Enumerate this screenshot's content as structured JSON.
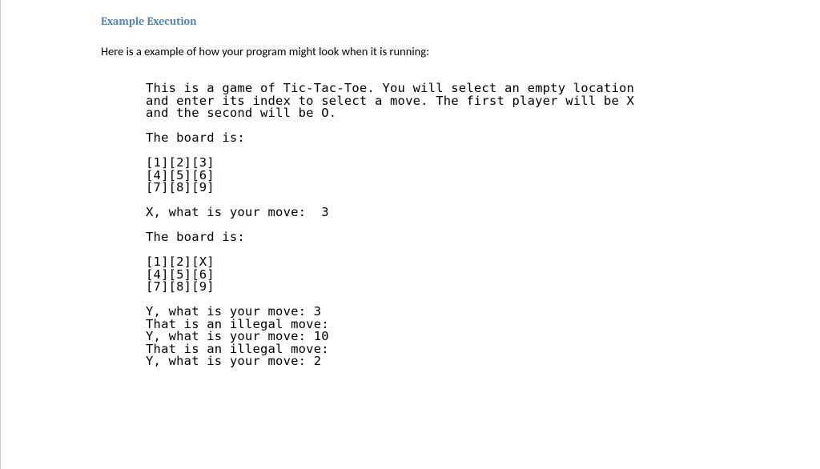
{
  "heading": "Example Execution",
  "intro": "Here is a example of how your program might look when it is running:",
  "code": "This is a game of Tic-Tac-Toe. You will select an empty location\nand enter its index to select a move. The first player will be X\nand the second will be O.\n\nThe board is:\n\n[1][2][3]\n[4][5][6]\n[7][8][9]\n\nX, what is your move:  3\n\nThe board is:\n\n[1][2][X]\n[4][5][6]\n[7][8][9]\n\nY, what is your move: 3\nThat is an illegal move:\nY, what is your move: 10\nThat is an illegal move:\nY, what is your move: 2"
}
